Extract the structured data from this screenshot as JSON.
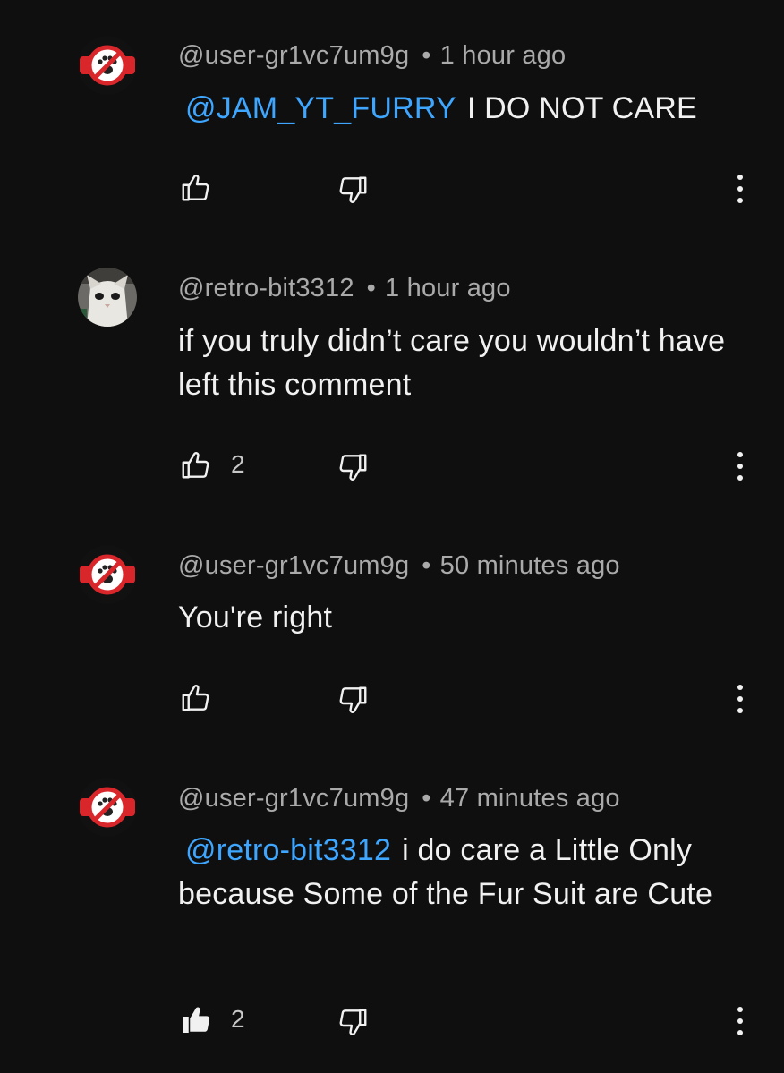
{
  "comments": [
    {
      "author": "@user-gr1vc7um9g",
      "separator": "•",
      "time": "1 hour ago",
      "mention": "@JAM_YT_FURRY",
      "text": "I DO NOT CARE",
      "like_count": "",
      "liked": false,
      "avatar": "no-furry-avatar"
    },
    {
      "author": "@retro-bit3312",
      "separator": "•",
      "time": "1 hour ago",
      "mention": "",
      "text": "if you truly didn’t care you wouldn’t have left this comment",
      "like_count": "2",
      "liked": false,
      "avatar": "cat-avatar"
    },
    {
      "author": "@user-gr1vc7um9g",
      "separator": "•",
      "time": "50 minutes ago",
      "mention": "",
      "text": "You're right",
      "like_count": "",
      "liked": false,
      "avatar": "no-furry-avatar"
    },
    {
      "author": "@user-gr1vc7um9g",
      "separator": "•",
      "time": "47 minutes ago",
      "mention": "@retro-bit3312",
      "text": "i do care a Little Only because Some of the Fur Suit are Cute",
      "like_count": "2",
      "liked": true,
      "avatar": "no-furry-avatar"
    }
  ],
  "icons": {
    "like": "thumbs-up-icon",
    "dislike": "thumbs-down-icon",
    "more": "more-vertical-icon"
  },
  "colors": {
    "background": "#0f0f0f",
    "mention": "#3ea6ff",
    "meta": "#aaaaaa",
    "text": "#f1f1f1"
  }
}
